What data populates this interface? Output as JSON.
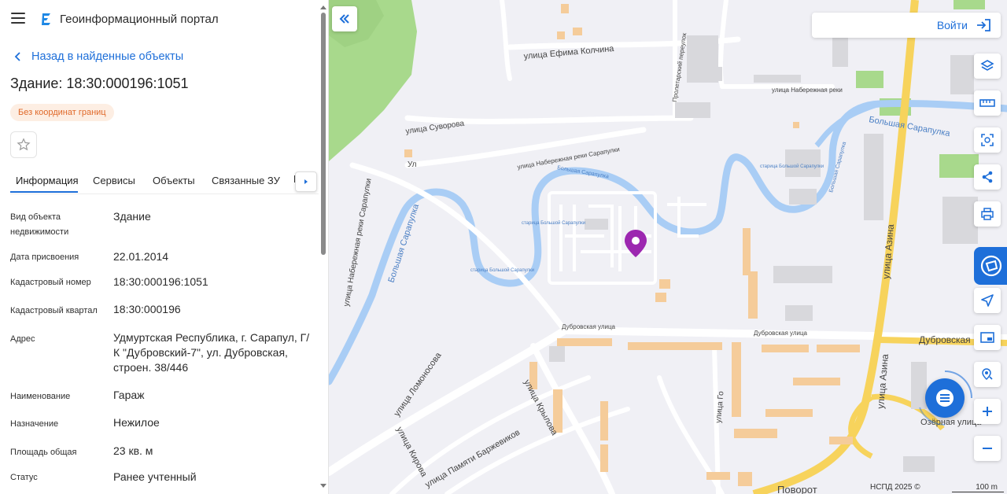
{
  "header": {
    "title": "Геоинформационный портал"
  },
  "back_link": {
    "label": "Назад в найденные объекты"
  },
  "object": {
    "title": "Здание: 18:30:000196:1051",
    "chip": "Без координат границ"
  },
  "tabs": [
    {
      "label": "Информация"
    },
    {
      "label": "Сервисы"
    },
    {
      "label": "Объекты"
    },
    {
      "label": "Связанные ЗУ"
    },
    {
      "label": "Н"
    }
  ],
  "properties": [
    {
      "key": "Вид объекта недвижимости",
      "value": "Здание"
    },
    {
      "key": "Дата присвоения",
      "value": "22.01.2014"
    },
    {
      "key": "Кадастровый номер",
      "value": "18:30:000196:1051"
    },
    {
      "key": "Кадастровый квартал",
      "value": "18:30:000196"
    },
    {
      "key": "Адрес",
      "value": "Удмуртская Республика, г. Сарапул, Г/К \"Дубровский-7\", ул. Дубровская, строен. 38/446"
    },
    {
      "key": "Наименование",
      "value": "Гараж"
    },
    {
      "key": "Назначение",
      "value": "Нежилое"
    },
    {
      "key": "Площадь общая",
      "value": "23 кв. м"
    },
    {
      "key": "Статус",
      "value": "Ранее учтенный"
    }
  ],
  "map": {
    "login_label": "Войти",
    "attribution": "НСПД 2025 ©",
    "scale_label": "100 m",
    "street_labels": [
      "улица Ефима Колчина",
      "Пролетарский переулок",
      "улица Набережная реки",
      "улица Суворова",
      "улица Набережная реки Сарапулки",
      "Ул",
      "Большая Сарапулка",
      "Большая Сарапулка",
      "улица Набережная реки Сарапулки",
      "Большая Сарапулка",
      "старица Большой Сарапулки",
      "старица Большой Сарапулки",
      "старица Большой Сарапулки",
      "Большая Сарапулка",
      "улица Азина",
      "Дубровская улица",
      "Дубровская улица",
      "Дубровская",
      "улица Ломоносова",
      "улица Крылова",
      "улица Кирова",
      "улица Памяти Баржевиков",
      "улица Го",
      "улица Азина",
      "Озёрная улица",
      "Поворот"
    ]
  },
  "colors": {
    "accent": "#1e6fd9",
    "chip_bg": "#fdeee3",
    "chip_text": "#e0692a",
    "marker": "#9c27b0",
    "water": "#a9cdf5",
    "park": "#a8d98c",
    "highway": "#f7d35c"
  },
  "icons": [
    "menu-icon",
    "portal-logo-icon",
    "chevron-left-icon",
    "star-icon",
    "chevron-right-icon",
    "double-chevron-left-icon",
    "login-icon",
    "layers-icon",
    "ruler-icon",
    "area-select-icon",
    "share-icon",
    "print-icon",
    "brand-icon",
    "locate-icon",
    "minimap-icon",
    "search-location-icon",
    "plus-icon",
    "minus-icon",
    "chat-icon",
    "map-pin-icon"
  ]
}
